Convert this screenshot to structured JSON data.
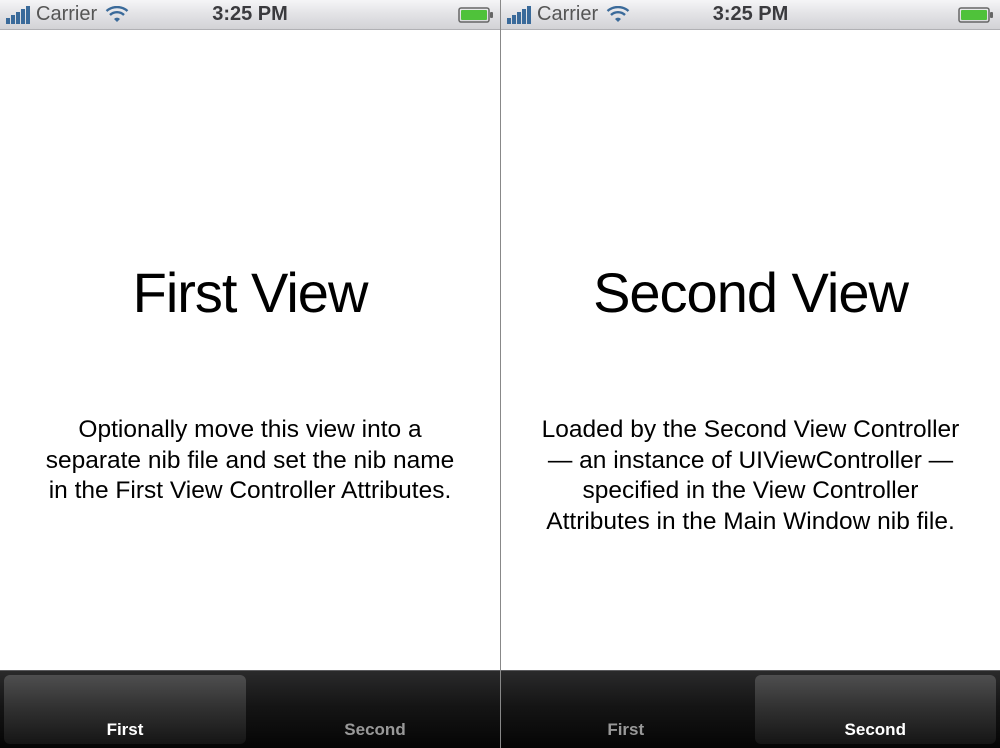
{
  "status": {
    "carrier": "Carrier",
    "time": "3:25 PM"
  },
  "screens": [
    {
      "title": "First View",
      "body": "Optionally move this view into a separate nib file and set the nib name in the First View Controller Attributes.",
      "tabs": [
        {
          "label": "First",
          "active": true
        },
        {
          "label": "Second",
          "active": false
        }
      ]
    },
    {
      "title": "Second View",
      "body": "Loaded by the Second View Controller — an instance of UIViewController — specified in the View Controller Attributes in the Main Window nib file.",
      "tabs": [
        {
          "label": "First",
          "active": false
        },
        {
          "label": "Second",
          "active": true
        }
      ]
    }
  ]
}
